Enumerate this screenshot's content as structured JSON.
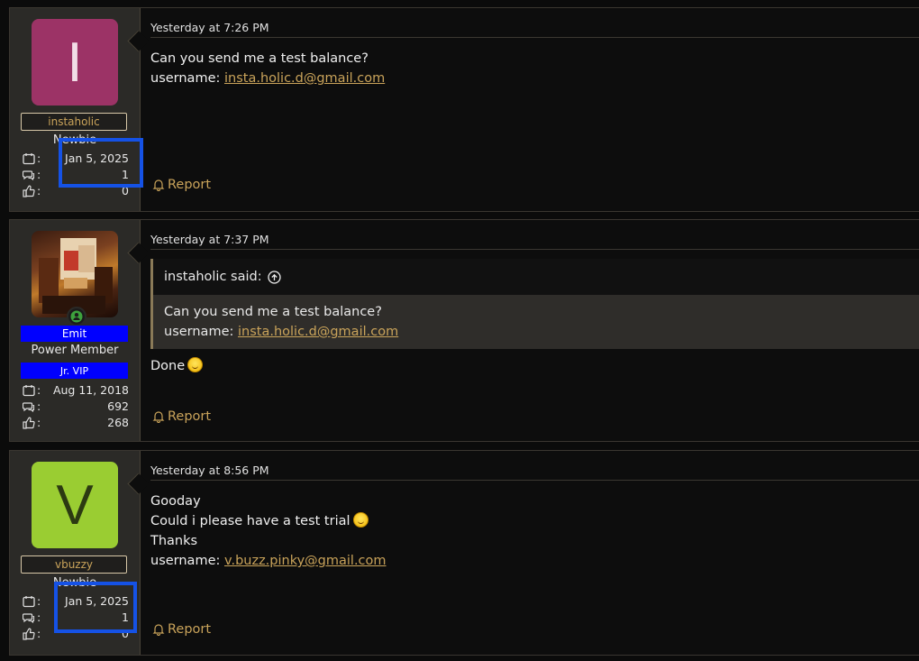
{
  "report_label": "Report",
  "posts": [
    {
      "avatar_letter": "I",
      "avatar_color": "#9c3366",
      "username": "instaholic",
      "user_title": "Newbie",
      "joined": "Jan 5, 2025",
      "messages": "1",
      "reactions": "0",
      "timestamp": "Yesterday at 7:26 PM",
      "line1": "Can you send me a test balance?",
      "line2_prefix": "username: ",
      "line2_link": "insta.holic.d@gmail.com"
    },
    {
      "username": "Emit",
      "user_title": "Power Member",
      "banner": "Jr. VIP",
      "joined": "Aug 11, 2018",
      "messages": "692",
      "reactions": "268",
      "timestamp": "Yesterday at 7:37 PM",
      "quote_author": "instaholic said:",
      "quote_line1": "Can you send me a test balance?",
      "quote_line2_prefix": "username: ",
      "quote_line2_link": "insta.holic.d@gmail.com",
      "reply": "Done"
    },
    {
      "avatar_letter": "V",
      "avatar_color": "#9acd32",
      "username": "vbuzzy",
      "user_title": "Newbie",
      "joined": "Jan 5, 2025",
      "messages": "1",
      "reactions": "0",
      "timestamp": "Yesterday at 8:56 PM",
      "line1": "Gooday",
      "line2": "Could i please have a test trial",
      "line3": "Thanks",
      "line4_prefix": "username: ",
      "line4_link": "v.buzz.pinky@gmail.com"
    }
  ],
  "icons": {
    "joined": "calendar-icon",
    "messages": "messages-icon",
    "reactions": "thumbs-up-icon",
    "report": "bell-icon",
    "quote_jump": "arrow-up-circle-icon",
    "online": "online-status-icon",
    "emoji": "smiley-emoji-icon"
  },
  "colors": {
    "link": "#c9a35a",
    "banner": "#0000ff",
    "highlight": "#1552e6",
    "sidebar_bg": "#2b2a27"
  }
}
